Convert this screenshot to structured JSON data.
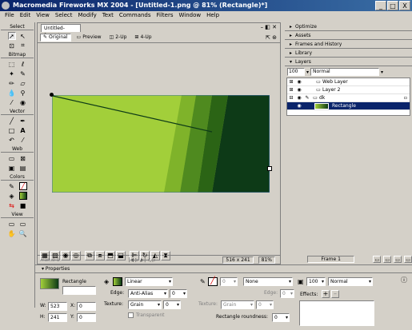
{
  "app": {
    "title": "Macromedia Fireworks MX 2004 - [Untitled-1.png @ 81% (Rectangle)*]",
    "window_buttons": [
      "_",
      "□",
      "X"
    ],
    "menu": [
      "File",
      "Edit",
      "View",
      "Select",
      "Modify",
      "Text",
      "Commands",
      "Filters",
      "Window",
      "Help"
    ]
  },
  "tools": {
    "sections": [
      "Select",
      "Bitmap",
      "Vector",
      "Web",
      "Colors",
      "View"
    ]
  },
  "document": {
    "tab": "Untitled-1.png*",
    "views": [
      "Original",
      "Preview",
      "2-Up",
      "4-Up"
    ],
    "status_frame": "Frame 1",
    "canvas_size": "516 x 241",
    "zoom": "81%"
  },
  "panels": {
    "sections": [
      "Optimize",
      "Assets",
      "Frames and History",
      "Library",
      "Layers"
    ],
    "layers": {
      "opacity": "100",
      "blend": "Normal",
      "rows": [
        "Web Layer",
        "Layer 2",
        "dk",
        "Rectangle"
      ],
      "footer": "Frame 1"
    }
  },
  "properties": {
    "title": "Properties",
    "object_name": "Rectangle",
    "w_label": "W:",
    "w_value": "523",
    "h_label": "H:",
    "h_value": "241",
    "x_label": "X:",
    "x_value": "0",
    "y_label": "Y:",
    "y_value": "0",
    "fill_type": "Linear",
    "edge_label": "Edge:",
    "edge_value": "Anti-Alias",
    "edge_amount": "0",
    "texture_label": "Texture:",
    "texture_value": "Grain",
    "texture_amount": "0",
    "transparent_label": "Transparent",
    "stroke_size": "0",
    "stroke_value": "None",
    "stroke_edge_label": "Edge:",
    "stroke_edge_value": "0",
    "stroke_texture_label": "Texture:",
    "stroke_texture_value": "Grain",
    "stroke_texture_amount": "0",
    "roundness_label": "Rectangle roundness:",
    "roundness_value": "0",
    "opacity_value": "100",
    "blend_value": "Normal",
    "effects_label": "Effects:"
  },
  "colors": {
    "canvas_light": "#a2cf3a",
    "canvas_mid": "#7fb32a",
    "canvas_dark": "#0d3a17",
    "selection_blue": "#0a246a"
  }
}
